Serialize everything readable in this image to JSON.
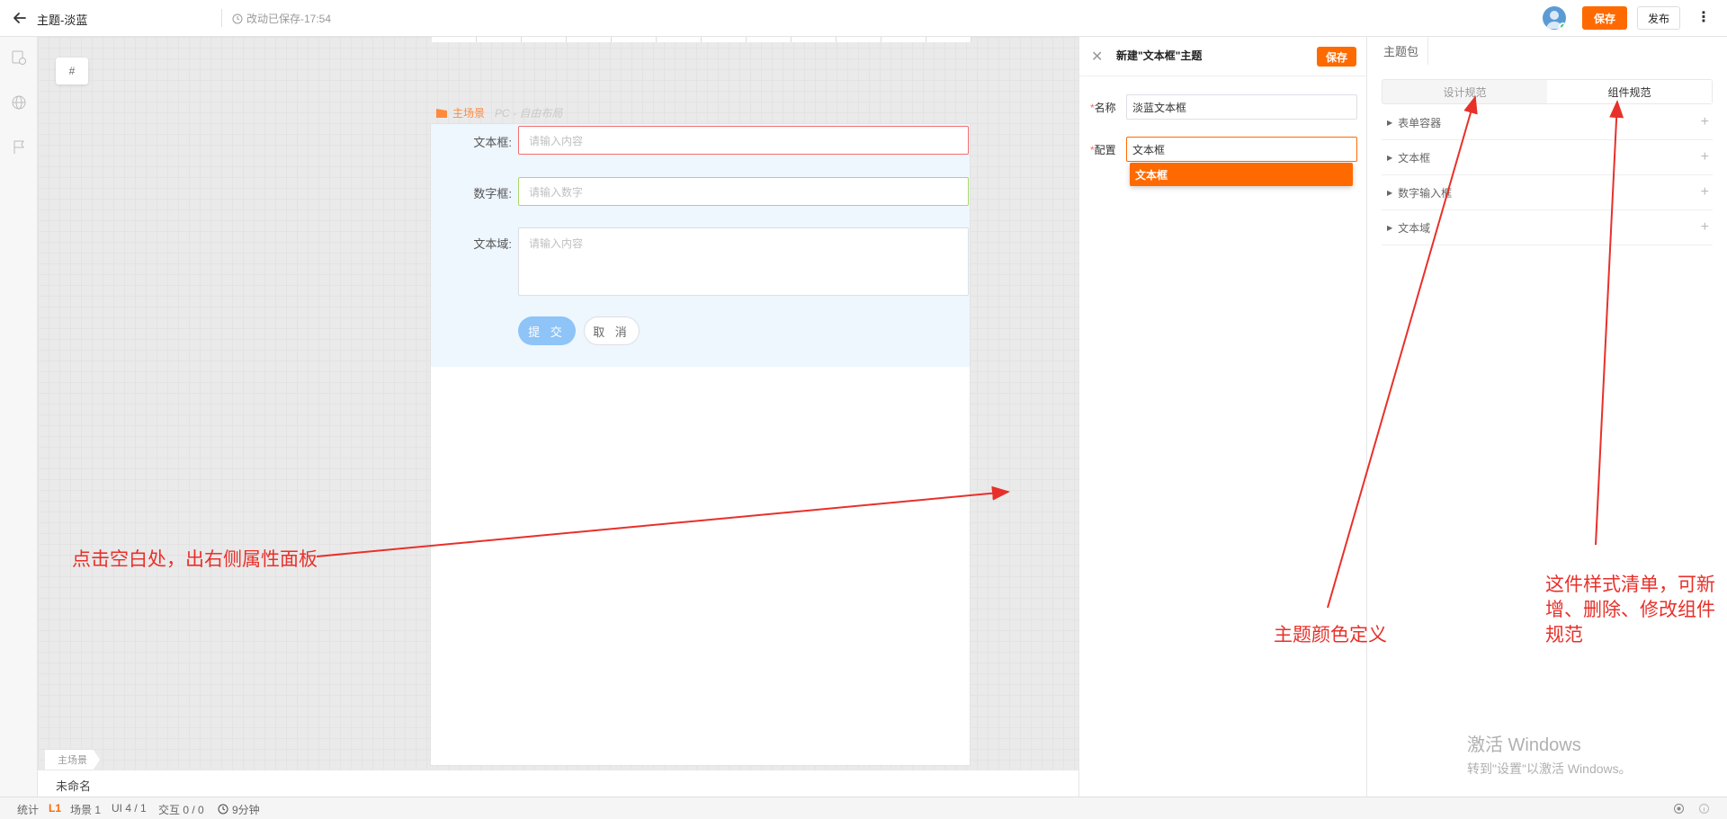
{
  "topbar": {
    "title": "主题-淡蓝",
    "saved_text": "改动已保存-17:54",
    "save_label": "保存",
    "publish_label": "发布",
    "more_icon": "⋮"
  },
  "canvas": {
    "hash_label": "#",
    "scene_name": "主场景",
    "scene_mode": "PC - 自由布局",
    "form": {
      "text_label": "文本框:",
      "text_placeholder": "请输入内容",
      "number_label": "数字框:",
      "number_placeholder": "请输入数字",
      "area_label": "文本域:",
      "area_placeholder": "请输入内容",
      "submit_label": "提 交",
      "cancel_label": "取 消"
    },
    "scene_tab": "主场景",
    "doc_name": "未命名"
  },
  "annotations": {
    "left": "点击空白处，出右侧属性面板",
    "middle": "主题颜色定义",
    "right": "这件样式清单，可新增、删除、修改组件规范",
    "color": "#e8302a"
  },
  "property_panel": {
    "title": "新建\"文本框\"主题",
    "save_label": "保存",
    "name_label": "名称",
    "name_value": "淡蓝文本框",
    "config_label": "配置",
    "config_value": "文本框",
    "dropdown_option": "文本框",
    "required_mark": "*"
  },
  "theme_panel": {
    "tab": "主题包",
    "seg_design": "设计规范",
    "seg_component": "组件规范",
    "rows": [
      {
        "label": "表单容器"
      },
      {
        "label": "文本框"
      },
      {
        "label": "数字输入框"
      },
      {
        "label": "文本域"
      }
    ],
    "plus": "+",
    "caret": "▶"
  },
  "watermark": {
    "line1": "激活 Windows",
    "line2": "转到\"设置\"以激活 Windows。"
  },
  "statusbar": {
    "stats_label": "统计",
    "level": "L1",
    "scene_count": "场景 1",
    "ui_count": "UI 4 / 1",
    "interact_count": "交互 0 / 0",
    "duration": "9分钟"
  },
  "colors": {
    "accent": "#ff6a00",
    "submit_blue": "#8ec4f7",
    "form_bg": "#eef6fe"
  }
}
